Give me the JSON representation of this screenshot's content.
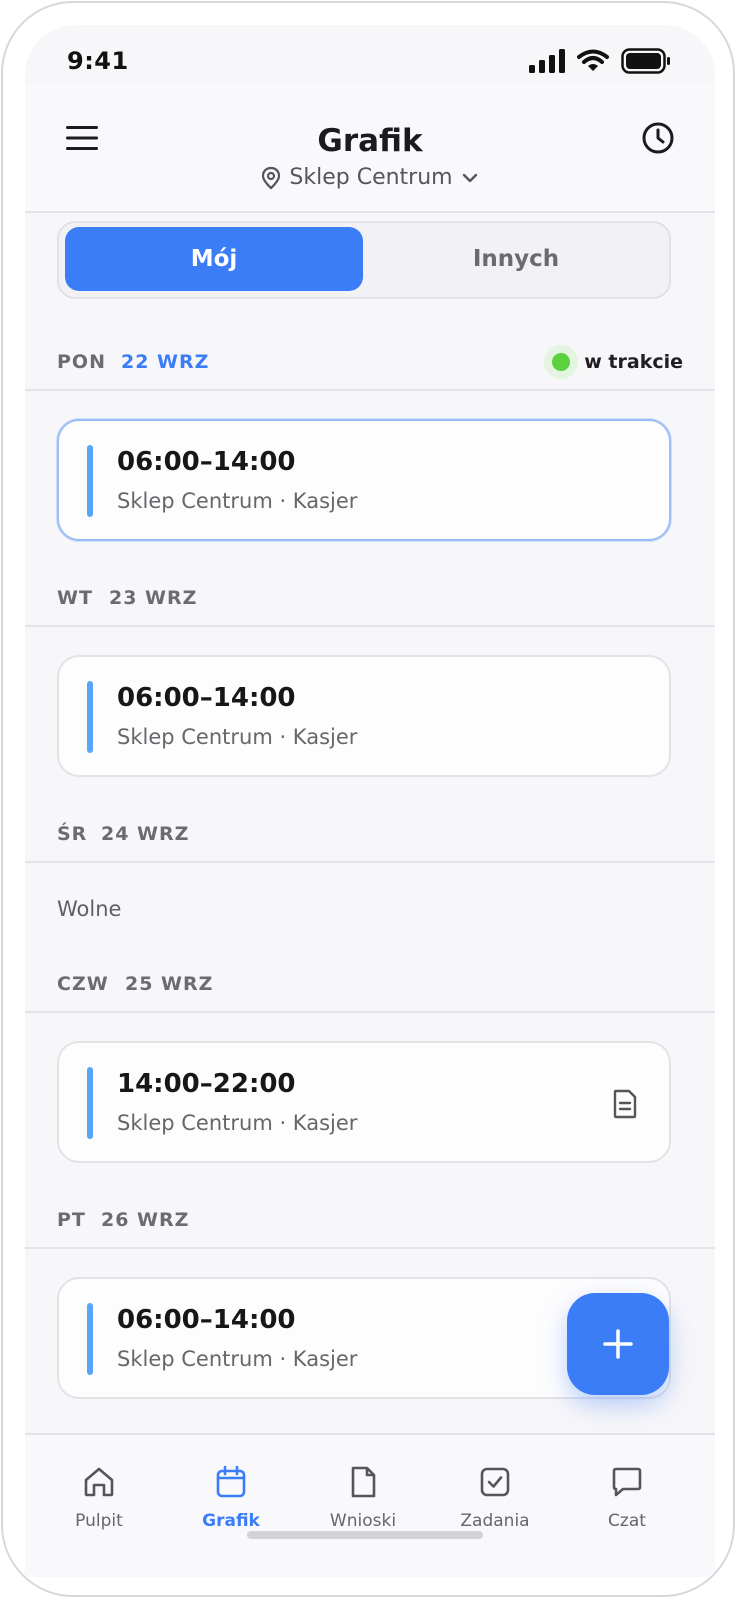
{
  "status_bar": {
    "time": "9:41"
  },
  "header": {
    "title": "Grafik",
    "location": "Sklep Centrum"
  },
  "segment": {
    "options": [
      "Mój",
      "Innych"
    ],
    "selected": "Mój"
  },
  "days": [
    {
      "day": "PON",
      "date": "22 WRZ",
      "is_today": true,
      "status": "w trakcie",
      "shift": {
        "time": "06:00–14:00",
        "place": "Sklep Centrum · Kasjer",
        "has_note": false
      }
    },
    {
      "day": "WT",
      "date": "23 WRZ",
      "shift": {
        "time": "06:00–14:00",
        "place": "Sklep Centrum · Kasjer",
        "has_note": false
      }
    },
    {
      "day": "ŚR",
      "date": "24 WRZ",
      "free_text": "Wolne"
    },
    {
      "day": "CZW",
      "date": "25 WRZ",
      "shift": {
        "time": "14:00–22:00",
        "place": "Sklep Centrum · Kasjer",
        "has_note": true
      }
    },
    {
      "day": "PT",
      "date": "26 WRZ",
      "shift": {
        "time": "06:00–14:00",
        "place": "Sklep Centrum · Kasjer",
        "has_note": false
      }
    }
  ],
  "bottom_nav": {
    "items": [
      {
        "label": "Pulpit",
        "icon": "home-icon"
      },
      {
        "label": "Grafik",
        "icon": "calendar-icon",
        "active": true
      },
      {
        "label": "Wnioski",
        "icon": "document-icon"
      },
      {
        "label": "Zadania",
        "icon": "checkbox-icon"
      },
      {
        "label": "Czat",
        "icon": "chat-icon"
      }
    ]
  },
  "colors": {
    "accent": "#3b7cf7",
    "shift_bar": "#58a6fb",
    "status_green": "#5bd13f",
    "background": "#f7f6f9"
  }
}
